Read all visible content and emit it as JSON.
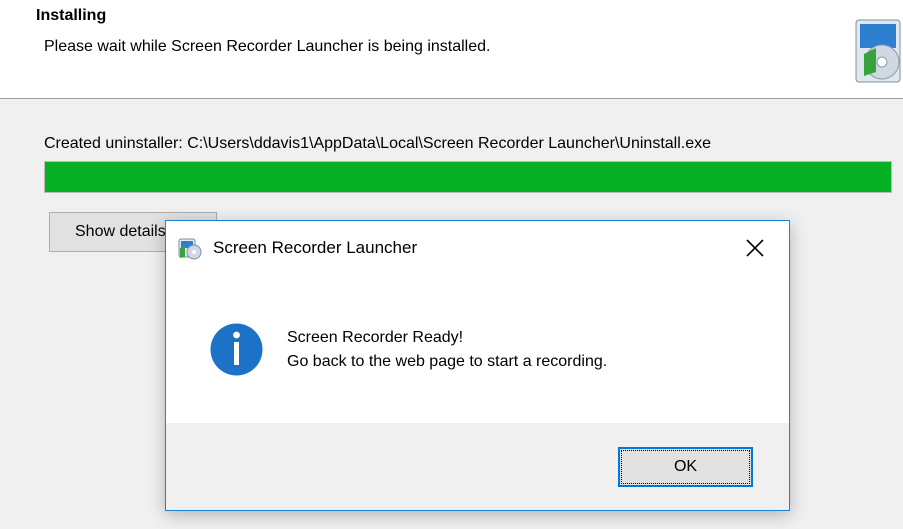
{
  "installer": {
    "title": "Installing",
    "subtitle": "Please wait while Screen Recorder Launcher is being installed.",
    "status_text": "Created uninstaller: C:\\Users\\ddavis1\\AppData\\Local\\Screen Recorder Launcher\\Uninstall.exe",
    "progress_percent": 100,
    "progress_color": "#06b025",
    "details_button_label": "Show details",
    "icon": "installer-package-icon"
  },
  "dialog": {
    "title": "Screen Recorder Launcher",
    "close_icon": "close-icon",
    "app_icon": "app-icon",
    "info_icon": "info-icon",
    "message_line1": "Screen Recorder Ready!",
    "message_line2": "Go back to the web page to start a recording.",
    "ok_label": "OK",
    "accent_color": "#0078d7"
  }
}
